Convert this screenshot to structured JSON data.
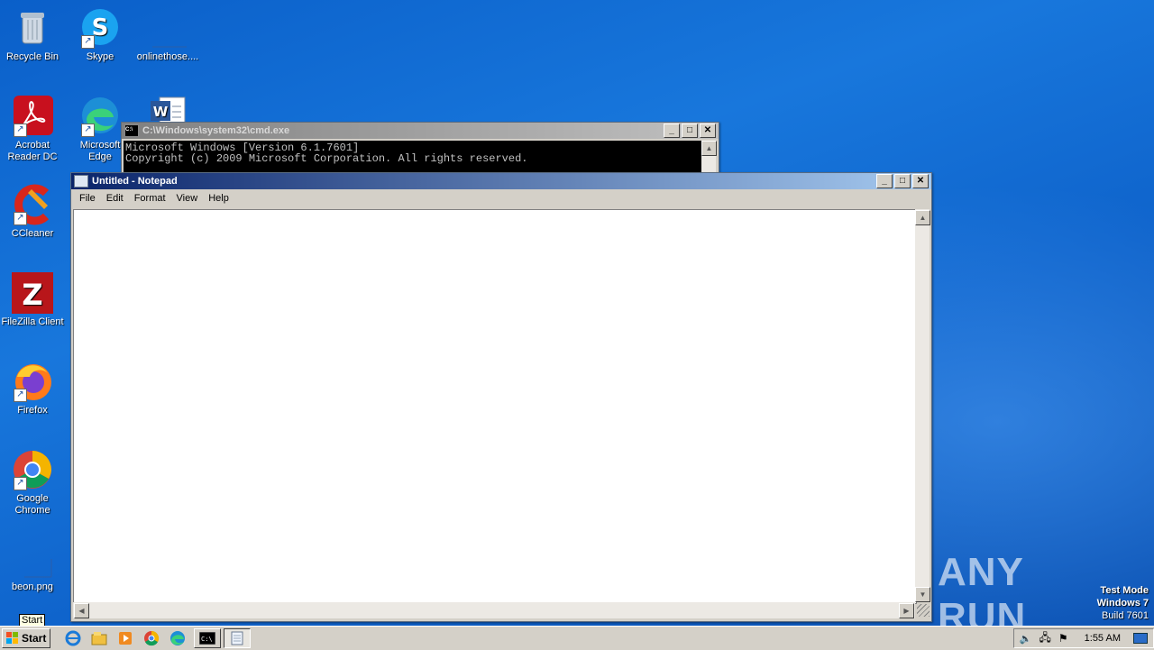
{
  "desktop": {
    "icons": [
      {
        "label": "Recycle Bin",
        "icon": "recycle-bin-icon"
      },
      {
        "label": "Skype",
        "icon": "skype-icon"
      },
      {
        "label": "onlinethose....",
        "icon": "file-icon"
      },
      {
        "label": "Acrobat Reader DC",
        "icon": "acrobat-icon"
      },
      {
        "label": "Microsoft Edge",
        "icon": "edge-icon"
      },
      {
        "label": "CCleaner",
        "icon": "ccleaner-icon"
      },
      {
        "label": "FileZilla Client",
        "icon": "filezilla-icon"
      },
      {
        "label": "Firefox",
        "icon": "firefox-icon"
      },
      {
        "label": "Google Chrome",
        "icon": "chrome-icon"
      },
      {
        "label": "beon.png",
        "icon": "image-file-icon"
      }
    ],
    "tooltip": "Start",
    "watermark": {
      "brand": "ANY RUN",
      "line1": "Test Mode",
      "line2": "Windows 7",
      "line3": "Build 7601"
    }
  },
  "cmd": {
    "title": "C:\\Windows\\system32\\cmd.exe",
    "lines": [
      "Microsoft Windows [Version 6.1.7601]",
      "Copyright (c) 2009 Microsoft Corporation.  All rights reserved."
    ]
  },
  "notepad": {
    "title": "Untitled - Notepad",
    "menu": [
      "File",
      "Edit",
      "Format",
      "View",
      "Help"
    ],
    "content": ""
  },
  "taskbar": {
    "start_label": "Start",
    "clock": "1:55 AM"
  },
  "colors": {
    "title_active": "#0a246a",
    "desktop": "#1877dc"
  }
}
